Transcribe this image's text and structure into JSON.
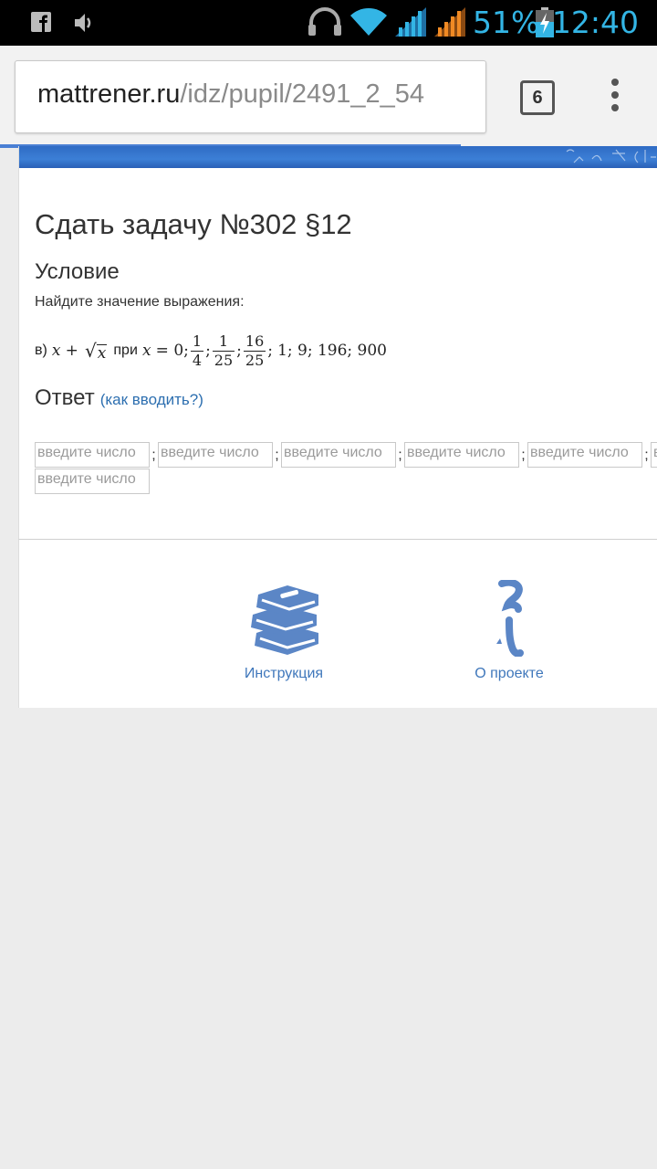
{
  "status_bar": {
    "battery_percent": "51%",
    "time": "12:40",
    "icons": [
      "facebook-icon",
      "volume-icon",
      "headphones-icon",
      "wifi-icon",
      "signal-icon",
      "signal-icon",
      "battery-charging-icon"
    ]
  },
  "browser": {
    "url_domain": "mattrener.ru",
    "url_path": "/idz/pupil/2491_2_54",
    "tab_count": "6",
    "accent_color": "#4a7fd4"
  },
  "page": {
    "title": "Сдать задачу №302 §12",
    "condition_heading": "Условие",
    "task_text": "Найдите значение выражения:",
    "expression": {
      "label": "в)",
      "x": "x",
      "plus": "+",
      "sqrt_arg": "x",
      "at_word": "при",
      "equals": "= 0;",
      "fractions": [
        {
          "num": "1",
          "den": "4"
        },
        {
          "num": "1",
          "den": "25"
        },
        {
          "num": "16",
          "den": "25"
        }
      ],
      "separator": ";",
      "tail": "1; 9; 196; 900"
    },
    "answer_heading": "Ответ",
    "answer_help_link": "(как вводить?)",
    "input_placeholder": "введите число",
    "input_separator": ";"
  },
  "footer": {
    "instruction_label": "Инструкция",
    "about_label": "О проекте",
    "icon_color": "#5b86c6"
  }
}
